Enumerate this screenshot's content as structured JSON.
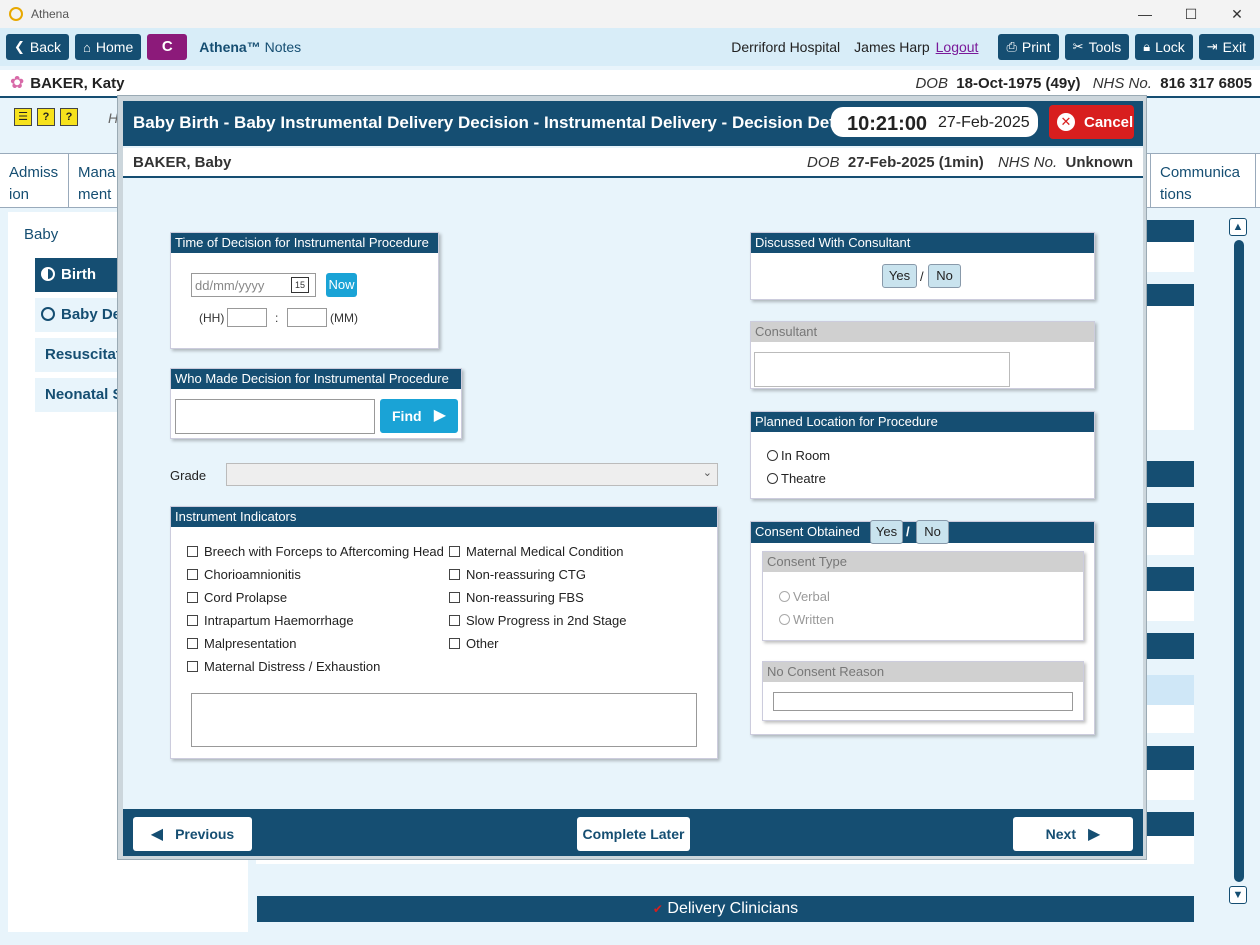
{
  "window": {
    "title": "Athena",
    "controls": [
      "—",
      "☐",
      "✕"
    ]
  },
  "toolbar": {
    "back": "Back",
    "home": "Home",
    "c": "C",
    "app_name_bold": "Athena™",
    "app_name_rest": " Notes",
    "hospital": "Derriford Hospital",
    "user": "James Harp",
    "logout": "Logout",
    "print": "Print",
    "tools": "Tools",
    "lock": "Lock",
    "exit": "Exit"
  },
  "patient": {
    "name": "BAKER, Katy",
    "dob_label": "DOB",
    "dob": "18-Oct-1975 (49y)",
    "nhs_label": "NHS No.",
    "nhs": "816 317 6805"
  },
  "background": {
    "tabs": [
      "Admiss ion",
      "Mana ment",
      "Communica tions"
    ],
    "left_items": [
      "Baby",
      "Birth",
      "Baby De",
      "Resuscitati",
      "Neonatal S"
    ],
    "footer_bar": "Delivery Clinicians",
    "partial_h": "H"
  },
  "modal": {
    "title": "Baby Birth - Baby Instrumental Delivery Decision - Instrumental Delivery - Decision Details",
    "time": "10:21:00",
    "date": "27-Feb-2025",
    "cancel": "Cancel",
    "baby": {
      "name": "BAKER, Baby",
      "dob_label": "DOB",
      "dob": "27-Feb-2025 (1min)",
      "nhs_label": "NHS No.",
      "nhs": "Unknown"
    },
    "decision_time": {
      "header": "Time of Decision for Instrumental Procedure",
      "date_placeholder": "dd/mm/yyyy",
      "now": "Now",
      "hh": "(HH)",
      "sep": ":",
      "mm": "(MM)"
    },
    "who": {
      "header": "Who Made Decision for Instrumental Procedure",
      "find": "Find"
    },
    "grade_label": "Grade",
    "indicators": {
      "header": "Instrument Indicators",
      "left": [
        "Breech with Forceps to Aftercoming Head",
        "Chorioamnionitis",
        "Cord Prolapse",
        "Intrapartum Haemorrhage",
        "Malpresentation",
        "Maternal Distress / Exhaustion"
      ],
      "right": [
        "Maternal Medical Condition",
        "Non-reassuring CTG",
        "Non-reassuring FBS",
        "Slow Progress in 2nd Stage",
        "Other"
      ]
    },
    "discussed": {
      "header": "Discussed With Consultant",
      "yes": "Yes",
      "sep": "/",
      "no": "No"
    },
    "consultant": {
      "header": "Consultant"
    },
    "location": {
      "header": "Planned Location for Procedure",
      "options": [
        "In Room",
        "Theatre"
      ]
    },
    "consent": {
      "header": "Consent Obtained",
      "yes": "Yes",
      "sep": "/",
      "no": "No",
      "type_header": "Consent Type",
      "type_options": [
        "Verbal",
        "Written"
      ],
      "no_reason_header": "No Consent Reason"
    },
    "footer": {
      "previous": "Previous",
      "complete_later": "Complete Later",
      "next": "Next"
    }
  }
}
